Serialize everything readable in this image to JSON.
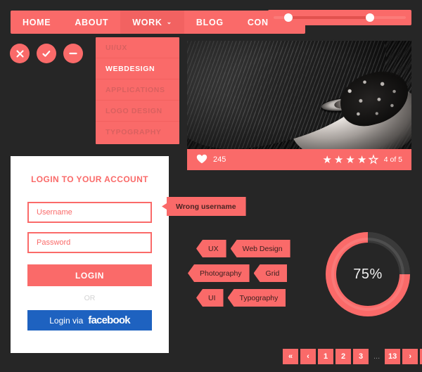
{
  "nav": {
    "items": [
      {
        "label": "HOME",
        "active": false,
        "caret": false
      },
      {
        "label": "ABOUT",
        "active": false,
        "caret": false
      },
      {
        "label": "WORK",
        "active": true,
        "caret": true
      },
      {
        "label": "BLOG",
        "active": false,
        "caret": false
      },
      {
        "label": "CONTACT",
        "active": false,
        "caret": false
      }
    ],
    "caret_glyph": "⌄"
  },
  "dropdown": {
    "items": [
      {
        "label": "UI/UX",
        "selected": false
      },
      {
        "label": "WEBDESIGN",
        "selected": true
      },
      {
        "label": "APPLICATIONS",
        "selected": false
      },
      {
        "label": "LOGO DESIGN",
        "selected": false
      },
      {
        "label": "TYPOGRAPHY",
        "selected": false
      }
    ]
  },
  "circle_buttons": [
    {
      "name": "close-button",
      "icon": "close-icon"
    },
    {
      "name": "confirm-button",
      "icon": "check-icon"
    },
    {
      "name": "minus-button",
      "icon": "minus-icon"
    }
  ],
  "slider": {
    "min_handle_pct": 14,
    "max_handle_pct": 71,
    "left_value": "",
    "right_value": ""
  },
  "photo_card": {
    "alt": "black-and-white portrait of woman with feather eye makeup",
    "likes_count": "245",
    "heart_icon": "heart-icon",
    "stars_filled": 4,
    "stars_total": 5,
    "rating_label": "4 of 5",
    "star_filled_glyph": "★",
    "star_empty_glyph": "★"
  },
  "login": {
    "title": "LOGIN TO YOUR ACCOUNT",
    "username_placeholder": "Username",
    "username_value": "",
    "password_placeholder": "Password",
    "password_value": "",
    "login_label": "LOGIN",
    "or_label": "OR",
    "facebook_prefix": "Login via",
    "facebook_brand": "facebook"
  },
  "tooltip": {
    "message": "Wrong username"
  },
  "tags": {
    "rows": [
      [
        "UX",
        "Web Design"
      ],
      [
        "Photography",
        "Grid"
      ],
      [
        "UI",
        "Typography"
      ]
    ]
  },
  "chart_data": {
    "type": "pie",
    "title": "",
    "label": "75%",
    "categories": [
      "completed",
      "remaining"
    ],
    "values": [
      75,
      25
    ],
    "colors": {
      "completed": "#fa6a69",
      "remaining": "#3a3a3a"
    },
    "start_angle_deg": 90,
    "legend": "none",
    "grid": false
  },
  "pagination": {
    "items": [
      {
        "label": "«",
        "name": "page-first",
        "dots": false
      },
      {
        "label": "‹",
        "name": "page-prev",
        "dots": false
      },
      {
        "label": "1",
        "name": "page-1",
        "dots": false
      },
      {
        "label": "2",
        "name": "page-2",
        "dots": false
      },
      {
        "label": "3",
        "name": "page-3",
        "dots": false
      },
      {
        "label": "...",
        "name": "page-ellipsis",
        "dots": true
      },
      {
        "label": "13",
        "name": "page-13",
        "dots": false
      },
      {
        "label": "›",
        "name": "page-next",
        "dots": false
      },
      {
        "label": "»",
        "name": "page-last",
        "dots": false
      }
    ]
  },
  "colors": {
    "accent": "#fa6a69",
    "accent_dark": "#f26261",
    "background": "#262626",
    "panel": "#ffffff",
    "facebook_blue": "#1e62c0",
    "donut_track": "#3a3a3a"
  }
}
